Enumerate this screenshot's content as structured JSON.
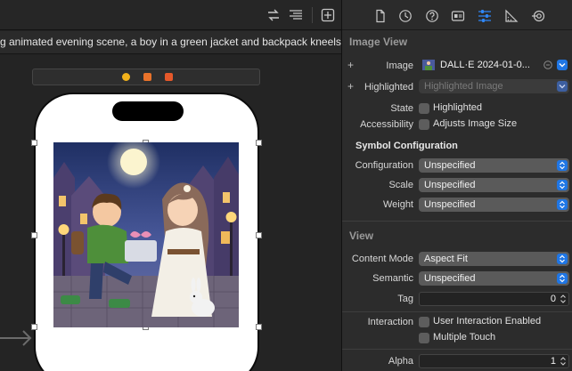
{
  "editor": {
    "path_text": "g animated evening scene, a boy in a green jacket and backpack kneels",
    "toolbar_icons": [
      "swap-arrows-icon",
      "text-align-icon",
      "add-editor-icon"
    ],
    "dock_icons": [
      "view-controller-icon",
      "first-responder-icon",
      "exit-icon"
    ],
    "colors": {
      "dock_yellow": "#f2b21b",
      "dock_orange": "#e8722a",
      "dock_red": "#e5582a"
    }
  },
  "inspector": {
    "tabs": [
      "file-icon",
      "history-icon",
      "help-icon",
      "identity-icon",
      "attributes-icon",
      "size-icon",
      "connections-icon"
    ],
    "image_view": {
      "title": "Image View",
      "image_label": "Image",
      "image_value": "DALL·E 2024-01-0...",
      "highlighted_label": "Highlighted",
      "highlighted_placeholder": "Highlighted Image",
      "state_label": "State",
      "state_checkbox": "Highlighted",
      "accessibility_label": "Accessibility",
      "accessibility_checkbox": "Adjusts Image Size"
    },
    "symbol_configuration": {
      "title": "Symbol Configuration",
      "configuration_label": "Configuration",
      "configuration_value": "Unspecified",
      "scale_label": "Scale",
      "scale_value": "Unspecified",
      "weight_label": "Weight",
      "weight_value": "Unspecified"
    },
    "view": {
      "title": "View",
      "content_mode_label": "Content Mode",
      "content_mode_value": "Aspect Fit",
      "semantic_label": "Semantic",
      "semantic_value": "Unspecified",
      "tag_label": "Tag",
      "tag_value": "0",
      "interaction_label": "Interaction",
      "interaction_checkbox_1": "User Interaction Enabled",
      "interaction_checkbox_2": "Multiple Touch",
      "alpha_label": "Alpha",
      "alpha_value": "1"
    },
    "colors": {
      "accent": "#1f76e5",
      "popup": "#5a5a5a",
      "panel": "#2c2c2c"
    }
  }
}
